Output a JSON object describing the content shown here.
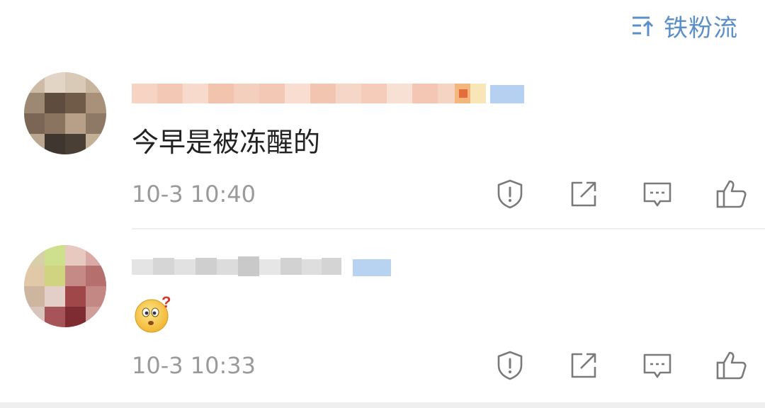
{
  "sort": {
    "label": "铁粉流",
    "icon": "sort-icon",
    "color": "#5b8fc7"
  },
  "comments": [
    {
      "text": "今早是被冻醒的",
      "timestamp": "10-3 10:40",
      "actions": [
        "report-icon",
        "share-icon",
        "comment-icon",
        "like-icon"
      ]
    },
    {
      "text": "",
      "emoji": "confused-emoji",
      "timestamp": "10-3 10:33",
      "actions": [
        "report-icon",
        "share-icon",
        "comment-icon",
        "like-icon"
      ]
    }
  ],
  "colors": {
    "accent": "#5b8fc7",
    "text": "#222222",
    "muted": "#9a9a9a",
    "icon": "#7a7a7a",
    "divider": "#eeeeee"
  }
}
